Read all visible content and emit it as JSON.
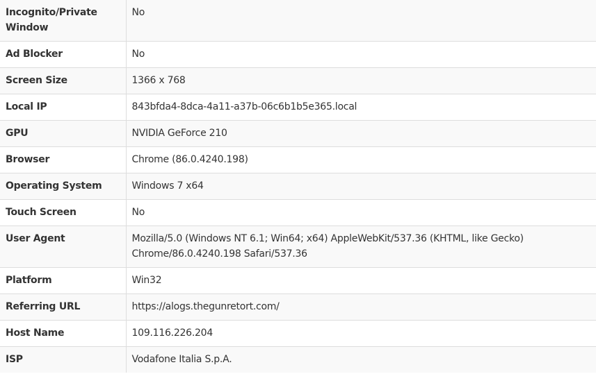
{
  "rows": [
    {
      "label": "Incognito/Private Window",
      "value": "No"
    },
    {
      "label": "Ad Blocker",
      "value": "No"
    },
    {
      "label": "Screen Size",
      "value": "1366 x 768"
    },
    {
      "label": "Local IP",
      "value": "843bfda4-8dca-4a11-a37b-06c6b1b5e365.local"
    },
    {
      "label": "GPU",
      "value": "NVIDIA GeForce 210"
    },
    {
      "label": "Browser",
      "value": "Chrome (86.0.4240.198)"
    },
    {
      "label": "Operating System",
      "value": "Windows 7 x64"
    },
    {
      "label": "Touch Screen",
      "value": "No"
    },
    {
      "label": "User Agent",
      "value": "Mozilla/5.0 (Windows NT 6.1; Win64; x64) AppleWebKit/537.36 (KHTML, like Gecko) Chrome/86.0.4240.198 Safari/537.36"
    },
    {
      "label": "Platform",
      "value": "Win32"
    },
    {
      "label": "Referring URL",
      "value": "https://alogs.thegunretort.com/"
    },
    {
      "label": "Host Name",
      "value": "109.116.226.204"
    },
    {
      "label": "ISP",
      "value": "Vodafone Italia S.p.A."
    }
  ]
}
